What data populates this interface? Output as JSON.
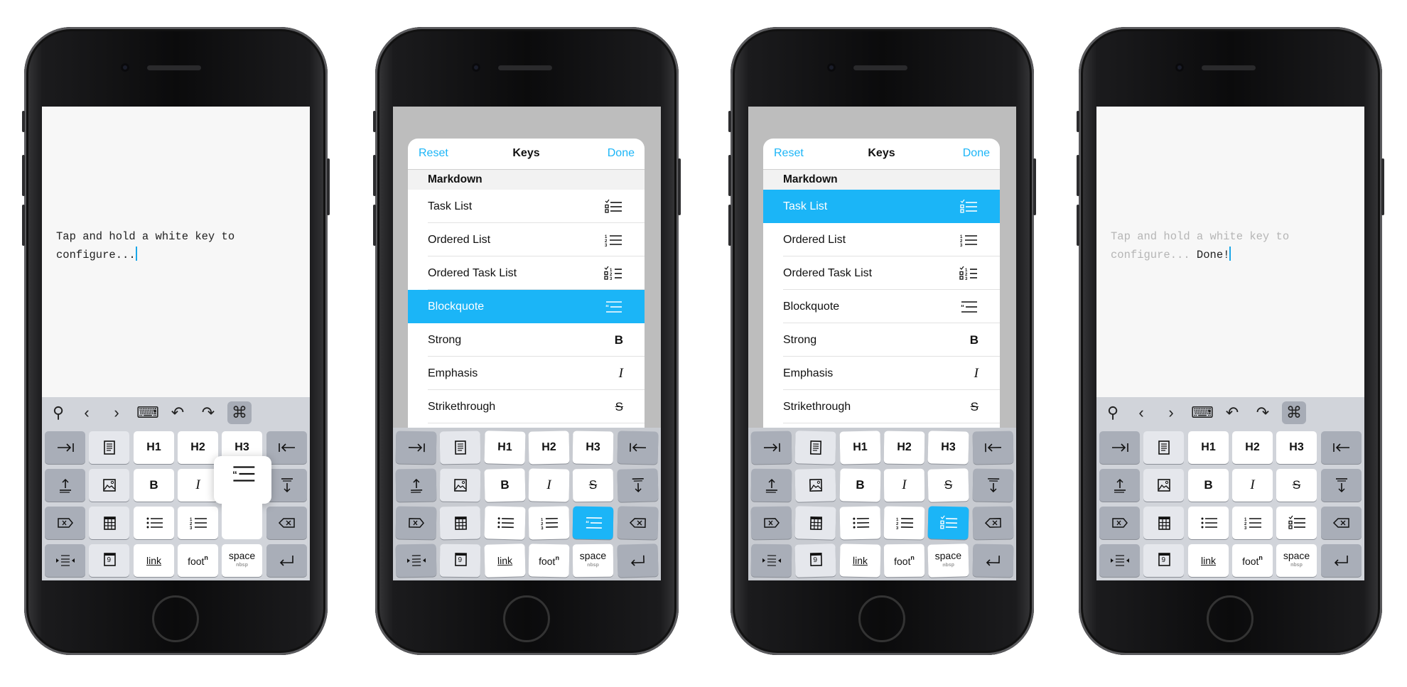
{
  "colors": {
    "accent": "#1bb5f7",
    "keyboard_bg": "#d1d4da",
    "gray_key": "#a9aeb8",
    "light_key": "#e5e7ec",
    "white_key": "#ffffff"
  },
  "toolbar": [
    {
      "icon": "search-icon",
      "glyph": "⚲"
    },
    {
      "icon": "chevron-left-icon",
      "glyph": "‹"
    },
    {
      "icon": "chevron-right-icon",
      "glyph": "›"
    },
    {
      "icon": "keyboard-dismiss-icon",
      "glyph": "⌨"
    },
    {
      "icon": "undo-icon",
      "glyph": "↶"
    },
    {
      "icon": "redo-icon",
      "glyph": "↷"
    },
    {
      "icon": "command-icon",
      "glyph": "⌘",
      "active": true
    }
  ],
  "keyboard": {
    "rows": [
      [
        {
          "style": "gray",
          "icon": "indent"
        },
        {
          "style": "light",
          "icon": "document"
        },
        {
          "style": "white",
          "label": "H1"
        },
        {
          "style": "white",
          "label": "H2"
        },
        {
          "style": "white",
          "label": "H3"
        },
        {
          "style": "gray",
          "icon": "outdent"
        }
      ],
      [
        {
          "style": "gray",
          "icon": "move-up"
        },
        {
          "style": "light",
          "icon": "image"
        },
        {
          "style": "white",
          "icon": "bold"
        },
        {
          "style": "white",
          "icon": "italic"
        },
        {
          "style": "white",
          "icon": "strikethrough"
        },
        {
          "style": "gray",
          "icon": "move-down"
        }
      ],
      [
        {
          "style": "gray",
          "icon": "clear"
        },
        {
          "style": "light",
          "icon": "table"
        },
        {
          "style": "white",
          "icon": "bullet-list"
        },
        {
          "style": "white",
          "icon": "ordered-list"
        },
        {
          "style": "white",
          "icon": "task-list"
        },
        {
          "style": "gray",
          "icon": "backspace"
        }
      ],
      [
        {
          "style": "gray",
          "icon": "center-align"
        },
        {
          "style": "light",
          "icon": "calendar",
          "label": "9"
        },
        {
          "style": "white",
          "label": "link",
          "kind": "link"
        },
        {
          "style": "white",
          "label": "foot",
          "sup": "n",
          "kind": "foot"
        },
        {
          "style": "white",
          "label": "space",
          "sub": "nbsp",
          "kind": "space"
        },
        {
          "style": "gray",
          "icon": "return"
        }
      ]
    ]
  },
  "dialog": {
    "reset": "Reset",
    "title": "Keys",
    "done": "Done",
    "section": "Markdown",
    "items": [
      {
        "label": "Task List",
        "icon": "task-list"
      },
      {
        "label": "Ordered List",
        "icon": "ordered-list"
      },
      {
        "label": "Ordered Task List",
        "icon": "ordered-task-list"
      },
      {
        "label": "Blockquote",
        "icon": "blockquote"
      },
      {
        "label": "Strong",
        "icon": "bold"
      },
      {
        "label": "Emphasis",
        "icon": "italic"
      },
      {
        "label": "Strikethrough",
        "icon": "strikethrough"
      }
    ]
  },
  "phones": [
    {
      "mode": "editor",
      "text": "Tap and hold a white key to\nconfigure...",
      "faded": false,
      "popup": {
        "icon": "blockquote"
      },
      "hidden_keys": [
        "1-4",
        "2-4"
      ]
    },
    {
      "mode": "dialog",
      "selected_item": 3,
      "key_overrides": {
        "2-4": {
          "style": "sel",
          "icon": "blockquote"
        }
      }
    },
    {
      "mode": "dialog",
      "selected_item": 0,
      "key_overrides": {
        "2-4": {
          "style": "sel",
          "icon": "task-list"
        }
      }
    },
    {
      "mode": "editor",
      "text": "Tap and hold a white key to\nconfigure... ",
      "done_text": "Done!",
      "faded": true
    }
  ]
}
